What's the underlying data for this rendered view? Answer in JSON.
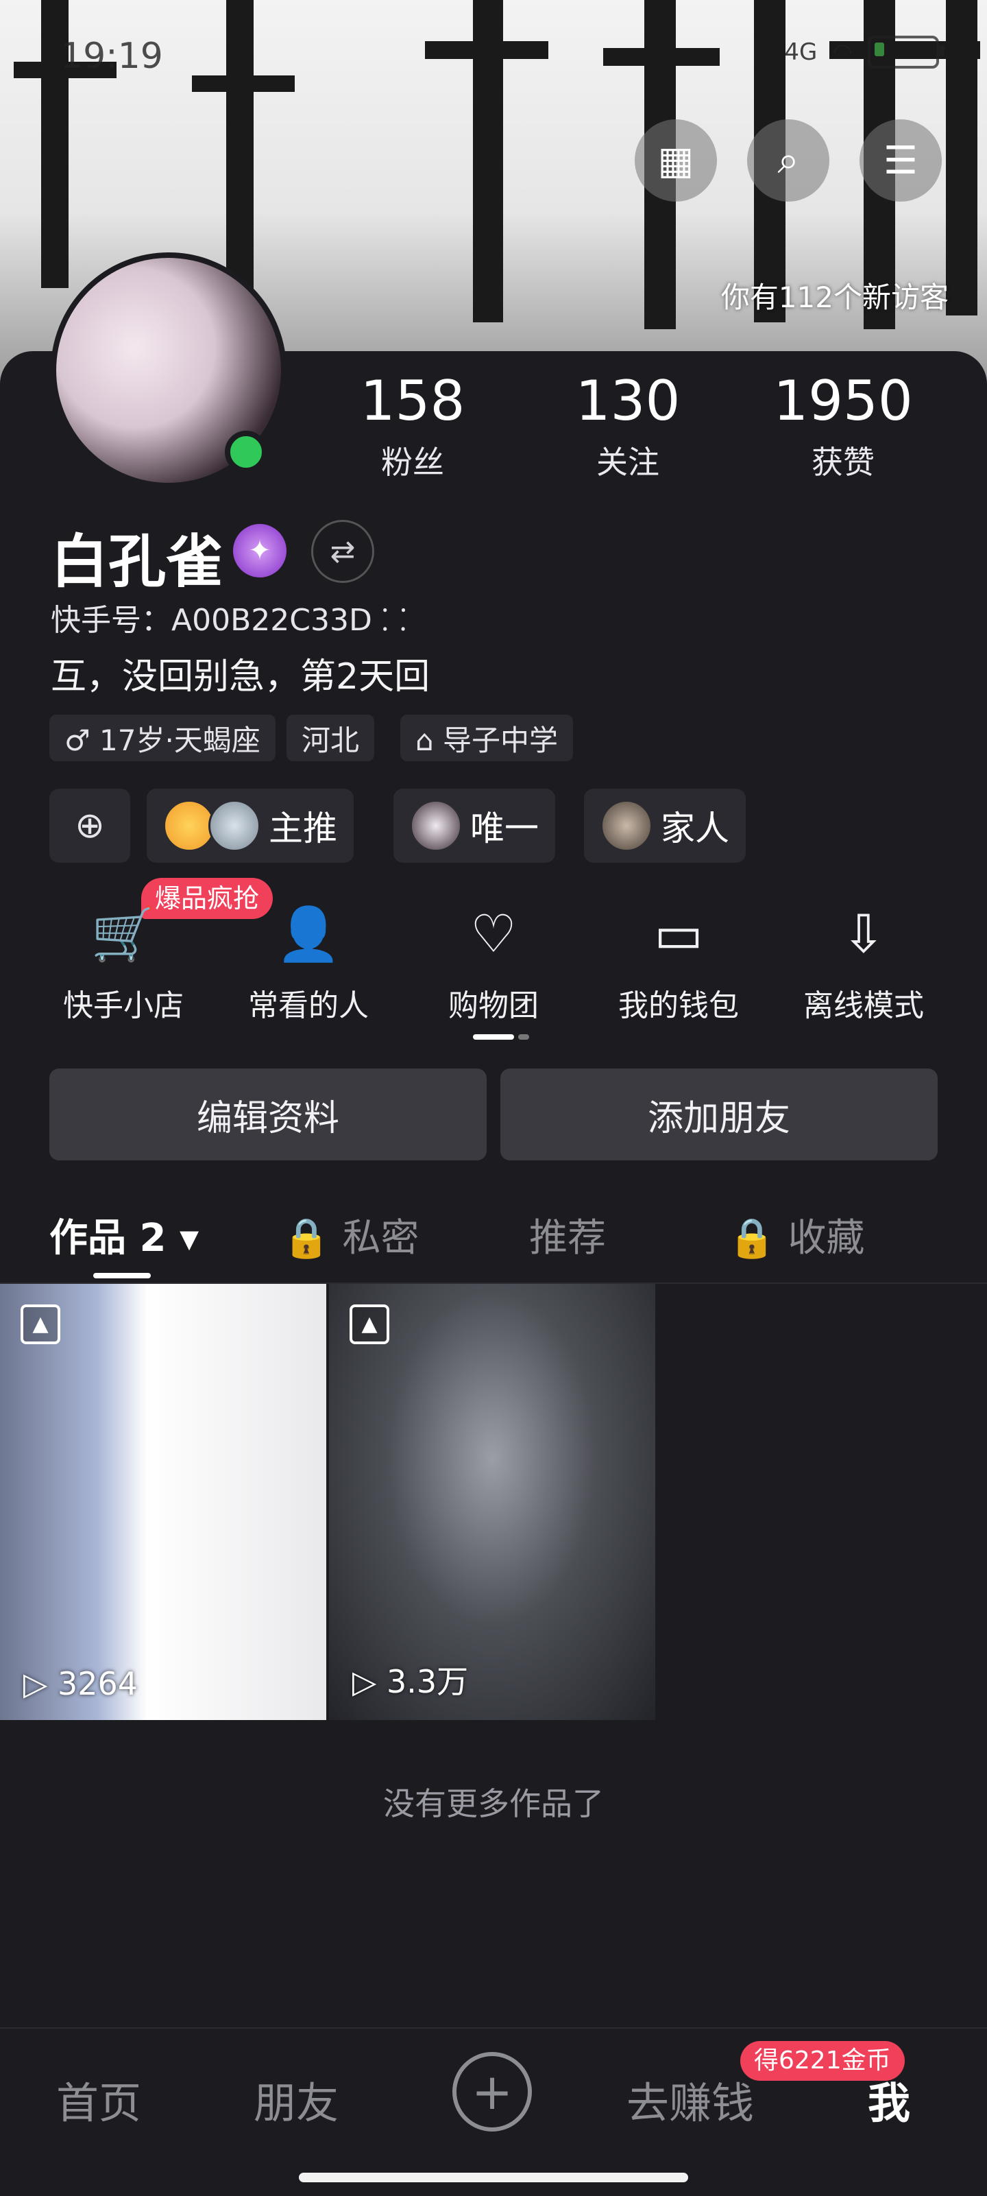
{
  "status": {
    "time": "19:19",
    "network": "4G",
    "battery": "11"
  },
  "banner": {
    "visitors": "你有112个新访客"
  },
  "top_buttons": [
    {
      "name": "calendar-icon",
      "glyph": "▦"
    },
    {
      "name": "search-icon",
      "glyph": "⌕"
    },
    {
      "name": "menu-icon",
      "glyph": "☰"
    }
  ],
  "profile": {
    "name": "白孔雀",
    "kuaishou_id": "快手号：A00B22C33D ⸬",
    "bio": "互，没回别急，第2天回",
    "stats": [
      {
        "num": "158",
        "label": "粉丝"
      },
      {
        "num": "130",
        "label": "关注"
      },
      {
        "num": "1950",
        "label": "获赞"
      }
    ],
    "tags": [
      "♂ 17岁·天蝎座",
      "河北",
      "⌂ 导子中学"
    ]
  },
  "circles": [
    {
      "label": "主推"
    },
    {
      "label": "唯一"
    },
    {
      "label": "家人"
    }
  ],
  "tools": {
    "hot_badge": "爆品疯抢",
    "items": [
      {
        "label": "快手小店",
        "glyph": "🛒"
      },
      {
        "label": "常看的人",
        "glyph": "👤"
      },
      {
        "label": "购物团",
        "glyph": "♡"
      },
      {
        "label": "我的钱包",
        "glyph": "▭"
      },
      {
        "label": "离线模式",
        "glyph": "⇩"
      }
    ]
  },
  "actions": {
    "edit": "编辑资料",
    "add_friend": "添加朋友"
  },
  "tabs": [
    "作品 2 ▾",
    "🔒 私密",
    "推荐",
    "🔒 收藏"
  ],
  "works": [
    {
      "plays": "▷ 3264"
    },
    {
      "plays": "▷ 3.3万"
    }
  ],
  "no_more": "没有更多作品了",
  "bottom_nav": {
    "home": "首页",
    "friends": "朋友",
    "plus": "+",
    "earn": "去赚钱",
    "me": "我",
    "coin_badge": "得6221金币"
  }
}
